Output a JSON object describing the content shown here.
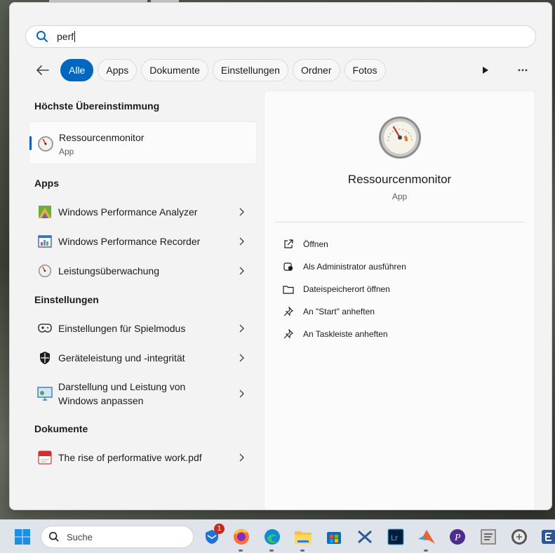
{
  "search": {
    "query": "perf"
  },
  "filters": [
    "Alle",
    "Apps",
    "Dokumente",
    "Einstellungen",
    "Ordner",
    "Fotos"
  ],
  "best_match": {
    "heading": "Höchste Übereinstimmung",
    "name": "Ressourcenmonitor",
    "type": "App"
  },
  "apps": {
    "heading": "Apps",
    "items": [
      {
        "label": "Windows Performance Analyzer",
        "icon": "performance-analyzer-icon"
      },
      {
        "label": "Windows Performance Recorder",
        "icon": "performance-recorder-icon"
      },
      {
        "label": "Leistungsüberwachung",
        "icon": "gauge-icon"
      }
    ]
  },
  "settings": {
    "heading": "Einstellungen",
    "items": [
      {
        "label": "Einstellungen für Spielmodus",
        "icon": "gamepad-icon"
      },
      {
        "label": "Geräteleistung und -integrität",
        "icon": "shield-icon"
      },
      {
        "label": "Darstellung und Leistung von Windows anpassen",
        "icon": "monitor-icon"
      }
    ]
  },
  "documents": {
    "heading": "Dokumente",
    "items": [
      {
        "label": "The rise of performative work.pdf",
        "icon": "pdf-icon"
      }
    ]
  },
  "detail": {
    "title": "Ressourcenmonitor",
    "type": "App",
    "actions": [
      {
        "label": "Öffnen",
        "icon": "open-external-icon"
      },
      {
        "label": "Als Administrator ausführen",
        "icon": "admin-shield-icon"
      },
      {
        "label": "Dateispeicherort öffnen",
        "icon": "folder-icon"
      },
      {
        "label": "An \"Start\" anheften",
        "icon": "pin-icon"
      },
      {
        "label": "An Taskleiste anheften",
        "icon": "pin-icon"
      }
    ]
  },
  "taskbar": {
    "search_label": "Suche",
    "mail_badge": "1"
  },
  "colors": {
    "accent": "#0067c0",
    "panel_bg": "#f3f3f3",
    "badge": "#c42b1c"
  }
}
